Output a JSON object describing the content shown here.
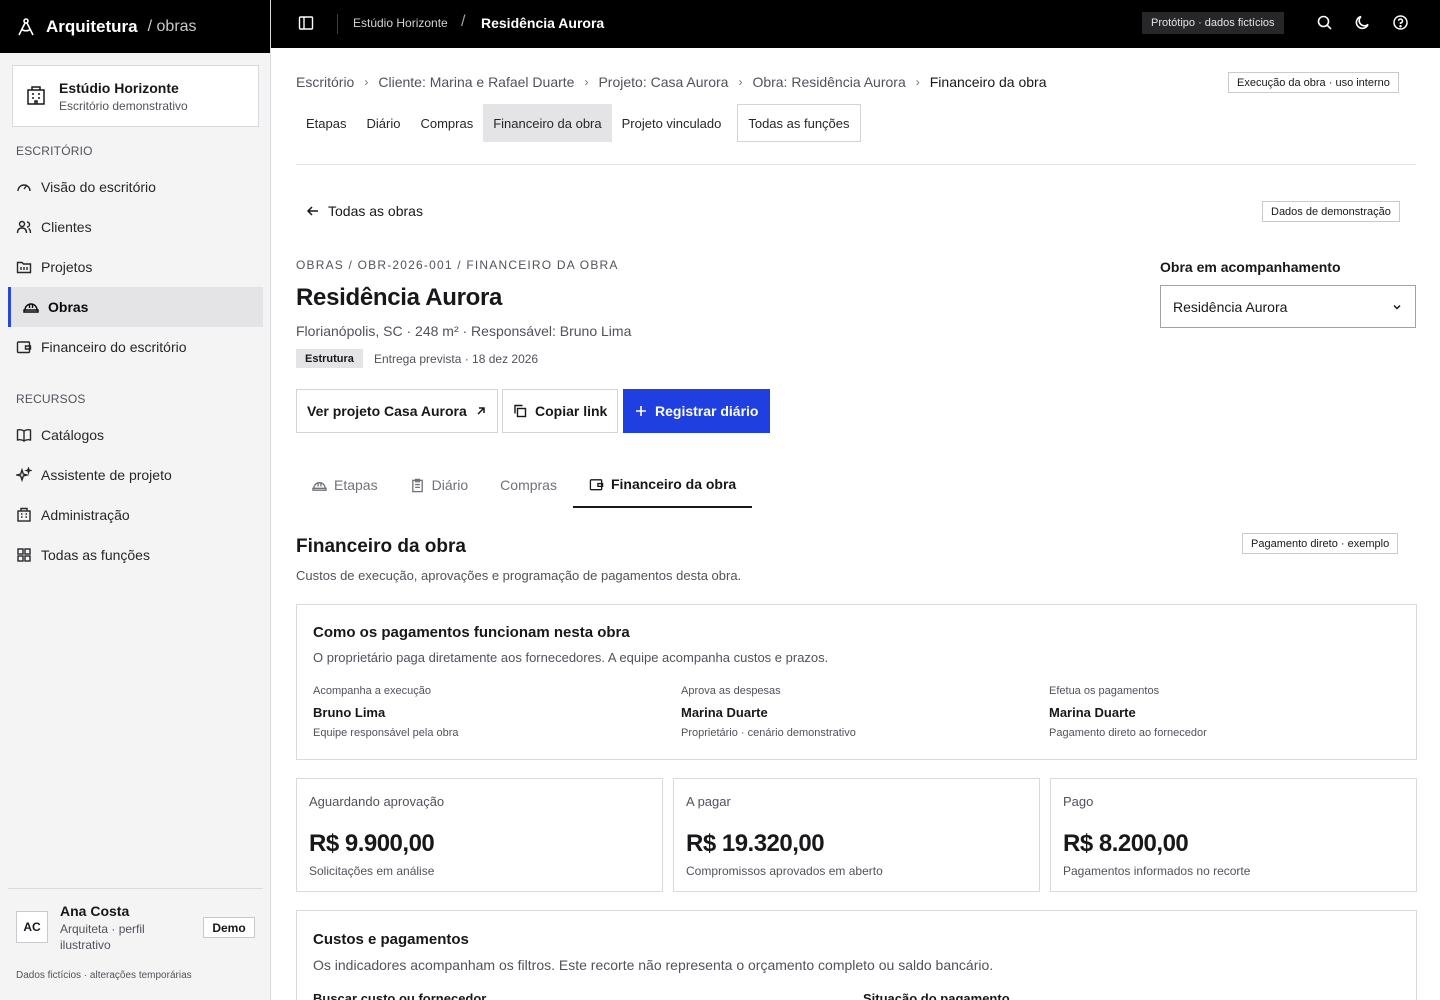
{
  "sidebar": {
    "brand_name": "Arquitetura",
    "brand_sub": "/ obras",
    "org_name": "Estúdio Horizonte",
    "org_sub": "Escritório demonstrativo",
    "section1": "ESCRITÓRIO",
    "section2": "RECURSOS",
    "items": [
      {
        "label": "Visão do escritório",
        "icon": "gauge-icon"
      },
      {
        "label": "Clientes",
        "icon": "users-icon"
      },
      {
        "label": "Projetos",
        "icon": "folder-icon"
      },
      {
        "label": "Obras",
        "icon": "hard-hat-icon",
        "active": true
      },
      {
        "label": "Financeiro do escritório",
        "icon": "wallet-icon"
      },
      {
        "label": "Catálogos",
        "icon": "book-icon"
      },
      {
        "label": "Assistente de projeto",
        "icon": "sparkles-icon"
      },
      {
        "label": "Administração",
        "icon": "building-icon"
      },
      {
        "label": "Todas as funções",
        "icon": "grid-icon"
      }
    ],
    "user": {
      "initials": "AC",
      "name": "Ana Costa",
      "role": "Arquiteta · perfil ilustrativo",
      "badge": "Demo"
    },
    "footer": "Dados fictícios · alterações temporárias"
  },
  "topbar": {
    "crumb1": "Estúdio Horizonte",
    "crumb2": "Residência Aurora",
    "badge": "Protótipo · dados fictícios"
  },
  "breadcrumbs": [
    "Escritório",
    "Cliente: Marina e Rafael Duarte",
    "Projeto: Casa Aurora",
    "Obra: Residência Aurora",
    "Financeiro da obra"
  ],
  "usage_tag": "Execução da obra · uso interno",
  "subnav": [
    "Etapas",
    "Diário",
    "Compras",
    "Financeiro da obra",
    "Projeto vinculado",
    "Todas as funções"
  ],
  "back_link": "Todas as obras",
  "demo_tag": "Dados de demonstração",
  "eyebrow": "OBRAS / OBR-2026-001 / FINANCEIRO DA OBRA",
  "title": "Residência Aurora",
  "meta": "Florianópolis, SC · 248 m² · Responsável: Bruno Lima",
  "stage_pill": "Estrutura",
  "delivery": "Entrega prevista · 18 dez 2026",
  "follow_label": "Obra em acompanhamento",
  "follow_value": "Residência Aurora",
  "buttons": {
    "view_project": "Ver projeto Casa Aurora",
    "copy_link": "Copiar link",
    "register": "Registrar diário"
  },
  "tabs": [
    "Etapas",
    "Diário",
    "Compras",
    "Financeiro da obra"
  ],
  "section_title": "Financeiro da obra",
  "section_sub": "Custos de execução, aprovações e programação de pagamentos desta obra.",
  "payment_tag": "Pagamento direto · exemplo",
  "how": {
    "title": "Como os pagamentos funcionam nesta obra",
    "sub": "O proprietário paga diretamente aos fornecedores. A equipe acompanha custos e prazos.",
    "cols": [
      {
        "k": "Acompanha a execução",
        "v": "Bruno Lima",
        "n": "Equipe responsável pela obra"
      },
      {
        "k": "Aprova as despesas",
        "v": "Marina Duarte",
        "n": "Proprietário · cenário demonstrativo"
      },
      {
        "k": "Efetua os pagamentos",
        "v": "Marina Duarte",
        "n": "Pagamento direto ao fornecedor"
      }
    ]
  },
  "kpis": [
    {
      "label": "Aguardando aprovação",
      "value": "R$ 9.900,00",
      "desc": "Solicitações em análise"
    },
    {
      "label": "A pagar",
      "value": "R$ 19.320,00",
      "desc": "Compromissos aprovados em aberto"
    },
    {
      "label": "Pago",
      "value": "R$ 8.200,00",
      "desc": "Pagamentos informados no recorte"
    }
  ],
  "costs": {
    "title": "Custos e pagamentos",
    "sub": "Os indicadores acompanham os filtros. Este recorte não representa o orçamento completo ou saldo bancário.",
    "filter1": "Buscar custo ou fornecedor",
    "filter2": "Situação do pagamento"
  },
  "colors": {
    "accent": "#1f3fe0",
    "active_bar": "#2548d8"
  }
}
